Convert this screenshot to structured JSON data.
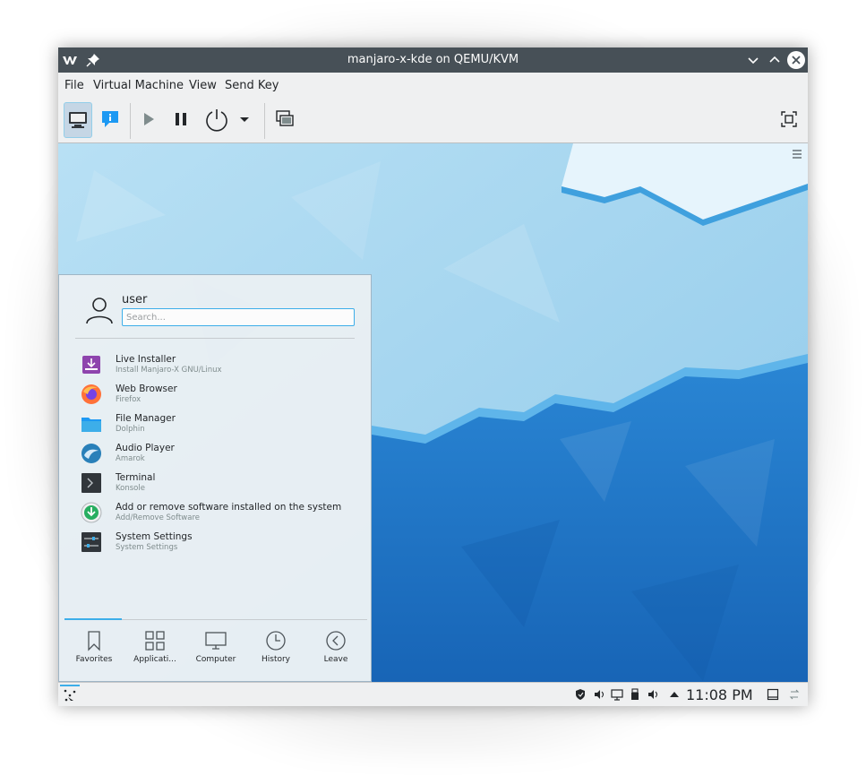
{
  "window": {
    "title": "manjaro-x-kde on QEMU/KVM"
  },
  "menubar": {
    "items": [
      "File",
      "Virtual Machine",
      "View",
      "Send Key"
    ]
  },
  "toolbar": {
    "icons": [
      "console-icon",
      "details-icon",
      "run-icon",
      "pause-icon",
      "shutdown-icon",
      "shutdown-menu-icon",
      "snapshots-icon",
      "fullscreen-icon"
    ]
  },
  "kickoff": {
    "username": "user",
    "search_placeholder": "Search...",
    "favorites": [
      {
        "name": "Live Installer",
        "sub": "Install Manjaro-X GNU/Linux",
        "icon": "installer-icon"
      },
      {
        "name": "Web Browser",
        "sub": "Firefox",
        "icon": "firefox-icon"
      },
      {
        "name": "File Manager",
        "sub": "Dolphin",
        "icon": "folder-icon"
      },
      {
        "name": "Audio Player",
        "sub": "Amarok",
        "icon": "amarok-icon"
      },
      {
        "name": "Terminal",
        "sub": "Konsole",
        "icon": "terminal-icon"
      },
      {
        "name": "Add or remove software installed on the system",
        "sub": "Add/Remove Software",
        "icon": "software-icon"
      },
      {
        "name": "System Settings",
        "sub": "System Settings",
        "icon": "settings-icon"
      }
    ],
    "tabs": [
      "Favorites",
      "Applicati...",
      "Computer",
      "History",
      "Leave"
    ]
  },
  "taskbar": {
    "clock": "11:08 PM"
  },
  "colors": {
    "titlebar": "#475057",
    "accent": "#3daee9",
    "wallpaper_light": "#a9d7f0",
    "wallpaper_dark": "#1f6fbf"
  }
}
